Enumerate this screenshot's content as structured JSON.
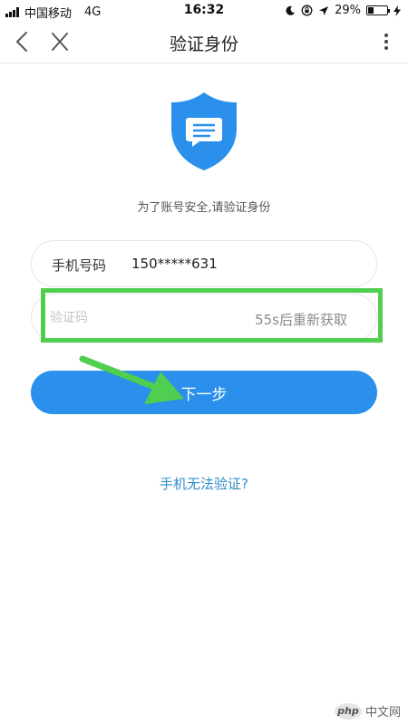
{
  "status_bar": {
    "carrier": "中国移动",
    "network": "4G",
    "time": "16:32",
    "battery_text": "29%",
    "battery_level": 0.29
  },
  "nav": {
    "title": "验证身份",
    "back_icon": "chevron-left-icon",
    "close_icon": "close-icon",
    "more_icon": "more-vertical-icon"
  },
  "shield": {
    "icon": "shield-message-icon",
    "color": "#2a90ec"
  },
  "subtitle": "为了账号安全,请验证身份",
  "phone_field": {
    "label": "手机号码",
    "value": "150*****631"
  },
  "code_field": {
    "placeholder": "验证码",
    "countdown": "55s后重新获取"
  },
  "next_button": {
    "label": "下一步",
    "color": "#2a90ec"
  },
  "help_link": "手机无法验证?",
  "annotations": {
    "highlight_color": "#4fce4f",
    "arrow_color": "#4fce4f"
  },
  "watermark": {
    "logo": "php",
    "text": "中文网"
  }
}
